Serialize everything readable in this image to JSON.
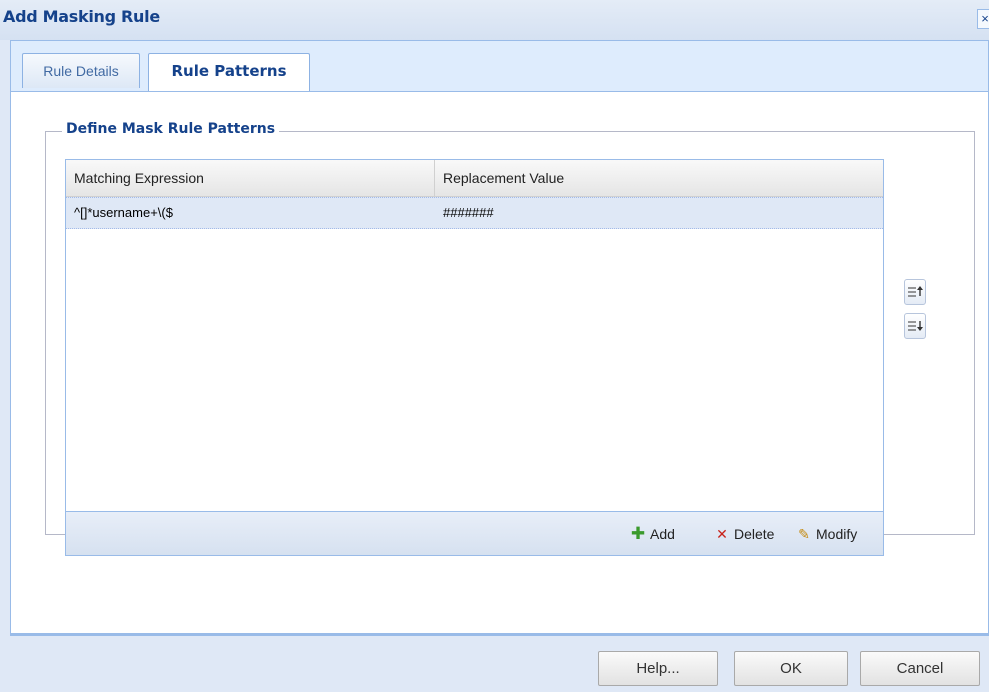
{
  "dialog": {
    "title": "Add Masking Rule",
    "close_glyph": "×"
  },
  "tabs": [
    {
      "label": "Rule Details",
      "active": false
    },
    {
      "label": "Rule Patterns",
      "active": true
    }
  ],
  "fieldset": {
    "legend": "Define Mask Rule Patterns"
  },
  "grid": {
    "columns": [
      "Matching Expression",
      "Replacement Value"
    ],
    "rows": [
      {
        "matching_expression": "^[]*username+\\($",
        "replacement_value": "#######",
        "selected": true
      }
    ]
  },
  "toolbar": {
    "add_label": "Add",
    "delete_label": "Delete",
    "modify_label": "Modify",
    "add_icon": "plus-icon",
    "delete_icon": "x-icon",
    "modify_icon": "pencil-icon"
  },
  "side_buttons": {
    "up_icon": "move-up-icon",
    "down_icon": "move-down-icon"
  },
  "footer": {
    "help_label": "Help...",
    "ok_label": "OK",
    "cancel_label": "Cancel"
  },
  "colors": {
    "title": "#15428b",
    "panel_border": "#99bbe8",
    "selected_row": "#dfe8f6",
    "add": "#3a9a2c",
    "delete": "#c8231b"
  }
}
